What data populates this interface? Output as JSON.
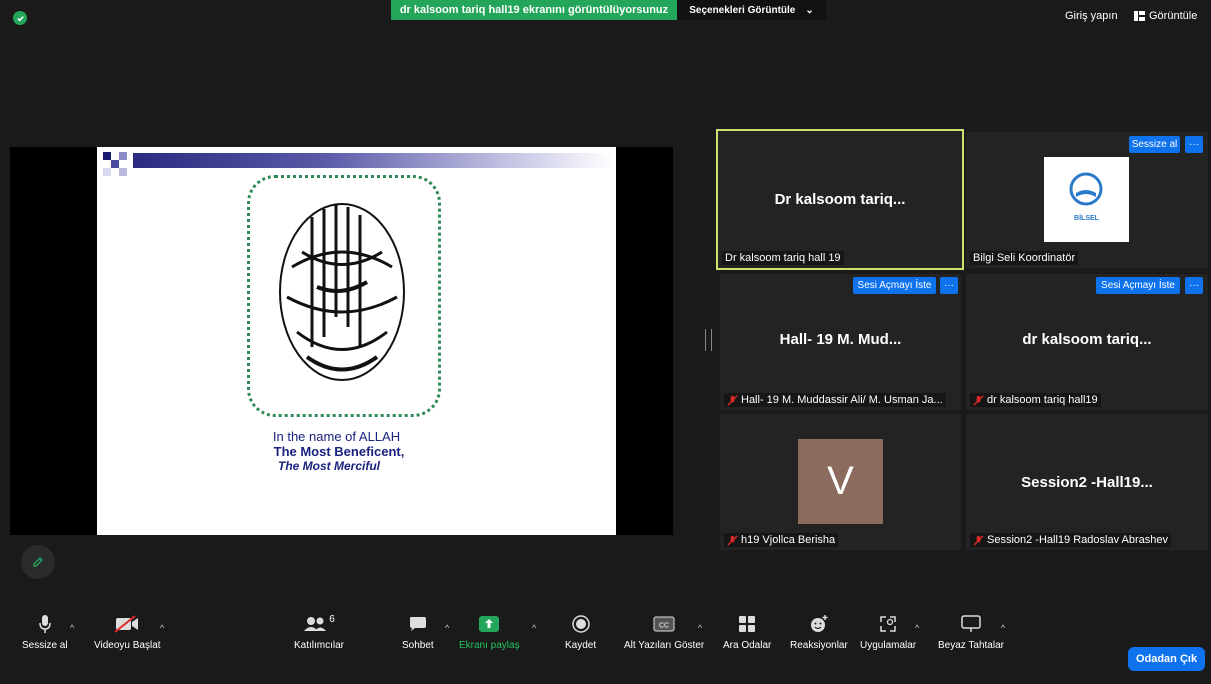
{
  "top": {
    "share_banner": "dr kalsoom tariq hall19 ekranını görüntülüyorsunuz",
    "view_options": "Seçenekleri Görüntüle",
    "signin": "Giriş yapın",
    "view": "Görüntüle"
  },
  "slide": {
    "line1": "In the name of ALLAH",
    "line2": "The Most Beneficent,",
    "line3": "The Most Merciful"
  },
  "tiles": [
    {
      "center": "Dr kalsoom tariq...",
      "name": "Dr kalsoom tariq hall 19"
    },
    {
      "name": "Bilgi Seli Koordinatör",
      "button": "Sessize al",
      "logo_text": "BİLSEL"
    },
    {
      "center": "Hall- 19 M. Mud...",
      "name": "Hall- 19 M. Muddassir Ali/ M. Usman Ja...",
      "button": "Sesi Açmayı İste"
    },
    {
      "center": "dr kalsoom tariq...",
      "name": "dr kalsoom tariq hall19",
      "button": "Sesi Açmayı İste"
    },
    {
      "avatar": "V",
      "name": "h19 Vjollca Berisha"
    },
    {
      "center": "Session2 -Hall19...",
      "name": "Session2 -Hall19 Radoslav Abrashev"
    }
  ],
  "more": "···",
  "toolbar": {
    "mute": "Sessize al",
    "video": "Videoyu Başlat",
    "participants": "Katılımcılar",
    "participants_count": "6",
    "chat": "Sohbet",
    "share": "Ekranı paylaş",
    "record": "Kaydet",
    "captions": "Alt Yazıları Göster",
    "breakout": "Ara Odalar",
    "reactions": "Reaksiyonlar",
    "apps": "Uygulamalar",
    "whiteboard": "Beyaz Tahtalar",
    "leave": "Odadan Çık"
  },
  "colors": {
    "green": "#23a55a",
    "blue": "#0e72ed",
    "speaker_border": "#c8e36e"
  }
}
